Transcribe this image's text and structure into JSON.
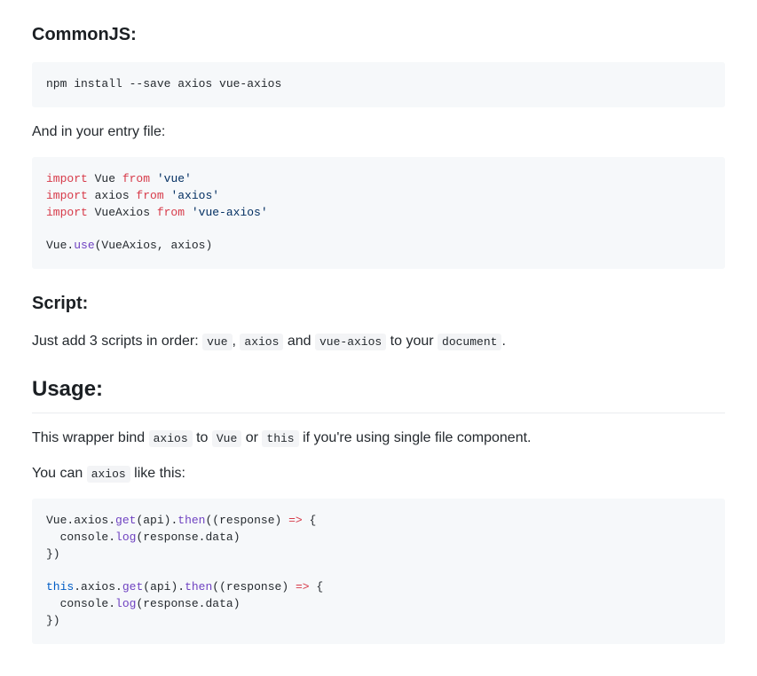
{
  "h_commonjs": "CommonJS:",
  "code_npm": "npm install --save axios vue-axios",
  "p_entryfile": "And in your entry file:",
  "code_imports": {
    "l1": {
      "import": "import",
      "name": " Vue ",
      "from": "from",
      "str": " 'vue'"
    },
    "l2": {
      "import": "import",
      "name": " axios ",
      "from": "from",
      "str": " 'axios'"
    },
    "l3": {
      "import": "import",
      "name": " VueAxios ",
      "from": "from",
      "str": " 'vue-axios'"
    },
    "use": {
      "pre": "Vue.",
      "fn": "use",
      "args": "(VueAxios, axios)"
    }
  },
  "h_script": "Script:",
  "p_script": {
    "t1": "Just add 3 scripts in order: ",
    "c1": "vue",
    "t2": ", ",
    "c2": "axios",
    "t3": " and ",
    "c3": "vue-axios",
    "t4": " to your ",
    "c4": "document",
    "t5": "."
  },
  "h_usage": "Usage:",
  "p_wrapper": {
    "t1": "This wrapper bind ",
    "c1": "axios",
    "t2": " to ",
    "c2": "Vue",
    "t3": " or ",
    "c3": "this",
    "t4": " if you're using single file component."
  },
  "p_youcan": {
    "t1": "You can ",
    "c1": "axios",
    "t2": " like this:"
  },
  "code_usage": {
    "b1": {
      "l1": {
        "a": "Vue.",
        "b": "axios",
        "c": ".",
        "d": "get",
        "e": "(api).",
        "f": "then",
        "g": "((",
        "h": "response",
        "i": ") ",
        "j": "=>",
        "k": " {"
      },
      "l2": {
        "a": "  ",
        "b": "console",
        "c": ".",
        "d": "log",
        "e": "(",
        "f": "response",
        "g": ".",
        "h": "data",
        "i": ")"
      },
      "l3": "})"
    },
    "b2": {
      "l1": {
        "a": "this",
        "b": ".",
        "c": "axios",
        "d": ".",
        "e": "get",
        "f": "(api).",
        "g": "then",
        "h": "((",
        "i": "response",
        "j": ") ",
        "k": "=>",
        "l": " {"
      },
      "l2": {
        "a": "  ",
        "b": "console",
        "c": ".",
        "d": "log",
        "e": "(",
        "f": "response",
        "g": ".",
        "h": "data",
        "i": ")"
      },
      "l3": "})"
    }
  }
}
